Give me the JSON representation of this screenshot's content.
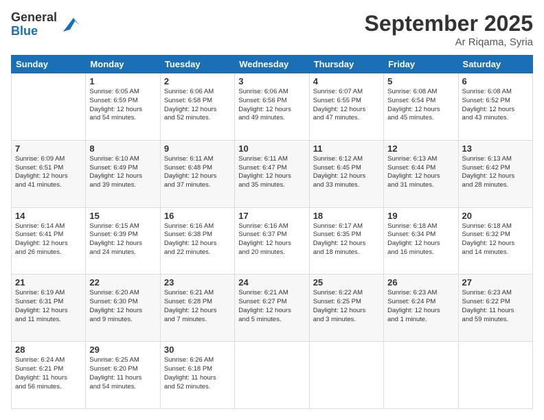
{
  "logo": {
    "general": "General",
    "blue": "Blue"
  },
  "header": {
    "month": "September 2025",
    "location": "Ar Riqama, Syria"
  },
  "days": [
    "Sunday",
    "Monday",
    "Tuesday",
    "Wednesday",
    "Thursday",
    "Friday",
    "Saturday"
  ],
  "weeks": [
    [
      {
        "day": "",
        "info": ""
      },
      {
        "day": "1",
        "info": "Sunrise: 6:05 AM\nSunset: 6:59 PM\nDaylight: 12 hours\nand 54 minutes."
      },
      {
        "day": "2",
        "info": "Sunrise: 6:06 AM\nSunset: 6:58 PM\nDaylight: 12 hours\nand 52 minutes."
      },
      {
        "day": "3",
        "info": "Sunrise: 6:06 AM\nSunset: 6:56 PM\nDaylight: 12 hours\nand 49 minutes."
      },
      {
        "day": "4",
        "info": "Sunrise: 6:07 AM\nSunset: 6:55 PM\nDaylight: 12 hours\nand 47 minutes."
      },
      {
        "day": "5",
        "info": "Sunrise: 6:08 AM\nSunset: 6:54 PM\nDaylight: 12 hours\nand 45 minutes."
      },
      {
        "day": "6",
        "info": "Sunrise: 6:08 AM\nSunset: 6:52 PM\nDaylight: 12 hours\nand 43 minutes."
      }
    ],
    [
      {
        "day": "7",
        "info": "Sunrise: 6:09 AM\nSunset: 6:51 PM\nDaylight: 12 hours\nand 41 minutes."
      },
      {
        "day": "8",
        "info": "Sunrise: 6:10 AM\nSunset: 6:49 PM\nDaylight: 12 hours\nand 39 minutes."
      },
      {
        "day": "9",
        "info": "Sunrise: 6:11 AM\nSunset: 6:48 PM\nDaylight: 12 hours\nand 37 minutes."
      },
      {
        "day": "10",
        "info": "Sunrise: 6:11 AM\nSunset: 6:47 PM\nDaylight: 12 hours\nand 35 minutes."
      },
      {
        "day": "11",
        "info": "Sunrise: 6:12 AM\nSunset: 6:45 PM\nDaylight: 12 hours\nand 33 minutes."
      },
      {
        "day": "12",
        "info": "Sunrise: 6:13 AM\nSunset: 6:44 PM\nDaylight: 12 hours\nand 31 minutes."
      },
      {
        "day": "13",
        "info": "Sunrise: 6:13 AM\nSunset: 6:42 PM\nDaylight: 12 hours\nand 28 minutes."
      }
    ],
    [
      {
        "day": "14",
        "info": "Sunrise: 6:14 AM\nSunset: 6:41 PM\nDaylight: 12 hours\nand 26 minutes."
      },
      {
        "day": "15",
        "info": "Sunrise: 6:15 AM\nSunset: 6:39 PM\nDaylight: 12 hours\nand 24 minutes."
      },
      {
        "day": "16",
        "info": "Sunrise: 6:16 AM\nSunset: 6:38 PM\nDaylight: 12 hours\nand 22 minutes."
      },
      {
        "day": "17",
        "info": "Sunrise: 6:16 AM\nSunset: 6:37 PM\nDaylight: 12 hours\nand 20 minutes."
      },
      {
        "day": "18",
        "info": "Sunrise: 6:17 AM\nSunset: 6:35 PM\nDaylight: 12 hours\nand 18 minutes."
      },
      {
        "day": "19",
        "info": "Sunrise: 6:18 AM\nSunset: 6:34 PM\nDaylight: 12 hours\nand 16 minutes."
      },
      {
        "day": "20",
        "info": "Sunrise: 6:18 AM\nSunset: 6:32 PM\nDaylight: 12 hours\nand 14 minutes."
      }
    ],
    [
      {
        "day": "21",
        "info": "Sunrise: 6:19 AM\nSunset: 6:31 PM\nDaylight: 12 hours\nand 11 minutes."
      },
      {
        "day": "22",
        "info": "Sunrise: 6:20 AM\nSunset: 6:30 PM\nDaylight: 12 hours\nand 9 minutes."
      },
      {
        "day": "23",
        "info": "Sunrise: 6:21 AM\nSunset: 6:28 PM\nDaylight: 12 hours\nand 7 minutes."
      },
      {
        "day": "24",
        "info": "Sunrise: 6:21 AM\nSunset: 6:27 PM\nDaylight: 12 hours\nand 5 minutes."
      },
      {
        "day": "25",
        "info": "Sunrise: 6:22 AM\nSunset: 6:25 PM\nDaylight: 12 hours\nand 3 minutes."
      },
      {
        "day": "26",
        "info": "Sunrise: 6:23 AM\nSunset: 6:24 PM\nDaylight: 12 hours\nand 1 minute."
      },
      {
        "day": "27",
        "info": "Sunrise: 6:23 AM\nSunset: 6:22 PM\nDaylight: 11 hours\nand 59 minutes."
      }
    ],
    [
      {
        "day": "28",
        "info": "Sunrise: 6:24 AM\nSunset: 6:21 PM\nDaylight: 11 hours\nand 56 minutes."
      },
      {
        "day": "29",
        "info": "Sunrise: 6:25 AM\nSunset: 6:20 PM\nDaylight: 11 hours\nand 54 minutes."
      },
      {
        "day": "30",
        "info": "Sunrise: 6:26 AM\nSunset: 6:18 PM\nDaylight: 11 hours\nand 52 minutes."
      },
      {
        "day": "",
        "info": ""
      },
      {
        "day": "",
        "info": ""
      },
      {
        "day": "",
        "info": ""
      },
      {
        "day": "",
        "info": ""
      }
    ]
  ]
}
